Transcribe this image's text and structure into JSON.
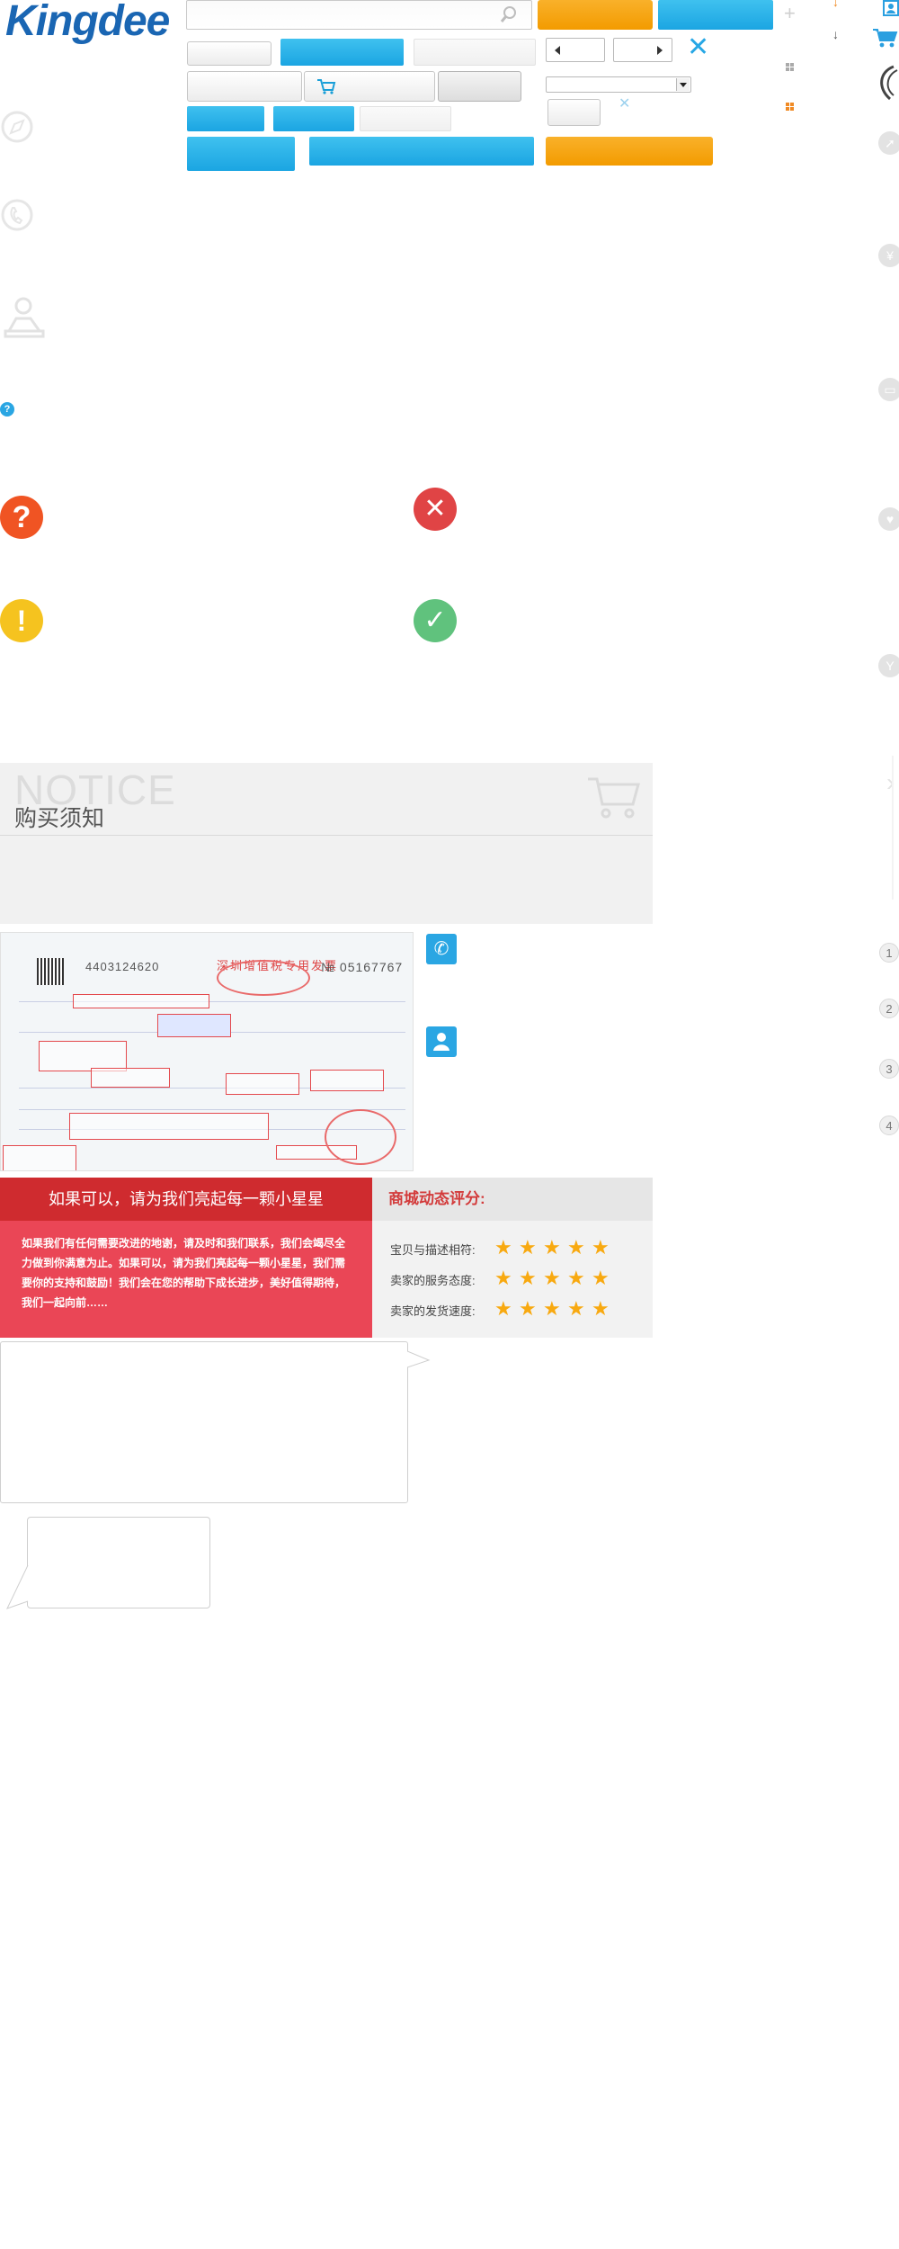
{
  "header": {
    "logo_text": "Kingdee",
    "search_placeholder": "",
    "brand_blue": "#1a66b3"
  },
  "buttons": {
    "primary_orange": "",
    "primary_blue": "",
    "cart_icon": "cart-add-icon"
  },
  "pager": {
    "prev_icon": "triangle-left-icon",
    "next_icon": "triangle-right-icon",
    "close_icon": "close-x-icon",
    "select_value": ""
  },
  "side_icons_left": [
    "compass-circle-icon",
    "phone-circle-icon",
    "customer-service-icon",
    "help-small-icon"
  ],
  "side_icons_right": [
    "user-icon",
    "cart-icon",
    "phone-icon",
    "compass-icon",
    "yen-icon",
    "card-icon",
    "heart-icon",
    "wrench-icon"
  ],
  "status_icons": [
    "question-icon",
    "error-icon",
    "warning-icon",
    "success-icon"
  ],
  "notice": {
    "title_en": "NOTICE",
    "title_cn": "购买须知"
  },
  "contact_icons": [
    "phone-icon",
    "user-icon"
  ],
  "step_numbers": [
    "1",
    "2",
    "3",
    "4"
  ],
  "invoice": {
    "number": "4403124620",
    "title": "深圳增值税专用发票",
    "serial": "№ 05167767"
  },
  "rating": {
    "left_title": "如果可以，请为我们亮起每一颗小星星",
    "left_body": "如果我们有任何需要改进的地谢，请及时和我们联系，我们会竭尽全力做到你满意为止。如果可以，请为我们亮起每一颗小星星，我们需要你的支持和鼓励！我们会在您的帮助下成长进步，美好值得期待，我们一起向前……",
    "right_title": "商城动态评分:",
    "rows": [
      {
        "label": "宝贝与描述相符:",
        "stars": 5
      },
      {
        "label": "卖家的服务态度:",
        "stars": 5
      },
      {
        "label": "卖家的发货速度:",
        "stars": 5
      }
    ],
    "star_color": "#f8a910"
  }
}
